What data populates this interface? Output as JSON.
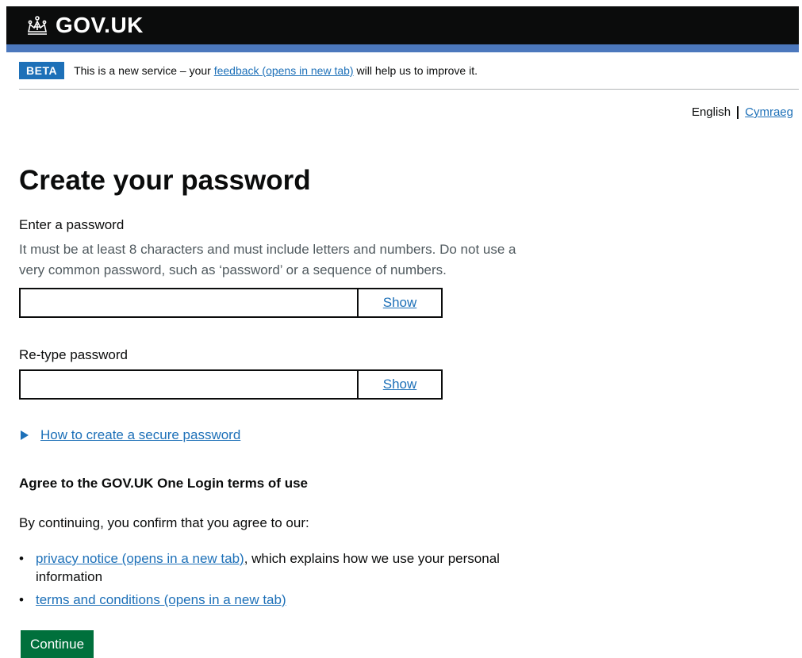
{
  "header": {
    "brand": "GOV.UK"
  },
  "phase_banner": {
    "tag": "BETA",
    "text_before": "This is a new service – your",
    "link": "feedback (opens in new tab)",
    "text_after": "will help us to improve it."
  },
  "language": {
    "current": "English",
    "other": "Cymraeg"
  },
  "page_title": "Create your password",
  "password": {
    "label": "Enter a password",
    "hint": "It must be at least 8 characters and must include letters and numbers. Do not use a very common password, such as ‘password’ or a sequence of numbers.",
    "value": "",
    "show_label": "Show"
  },
  "confirm_password": {
    "label": "Re-type password",
    "value": "",
    "show_label": "Show"
  },
  "details": {
    "summary": "How to create a secure password"
  },
  "terms": {
    "heading": "Agree to the GOV.UK One Login terms of use",
    "intro": "By continuing, you confirm that you agree to our:",
    "items": [
      {
        "link": "privacy notice (opens in a new tab)",
        "suffix": ", which explains how we use your personal information"
      },
      {
        "link": "terms and conditions (opens in a new tab)",
        "suffix": ""
      }
    ]
  },
  "continue_label": "Continue",
  "colors": {
    "brand_black": "#0b0c0c",
    "link_blue": "#1d70b8",
    "button_green": "#00703c",
    "beta_tag": "#1d70b8"
  }
}
